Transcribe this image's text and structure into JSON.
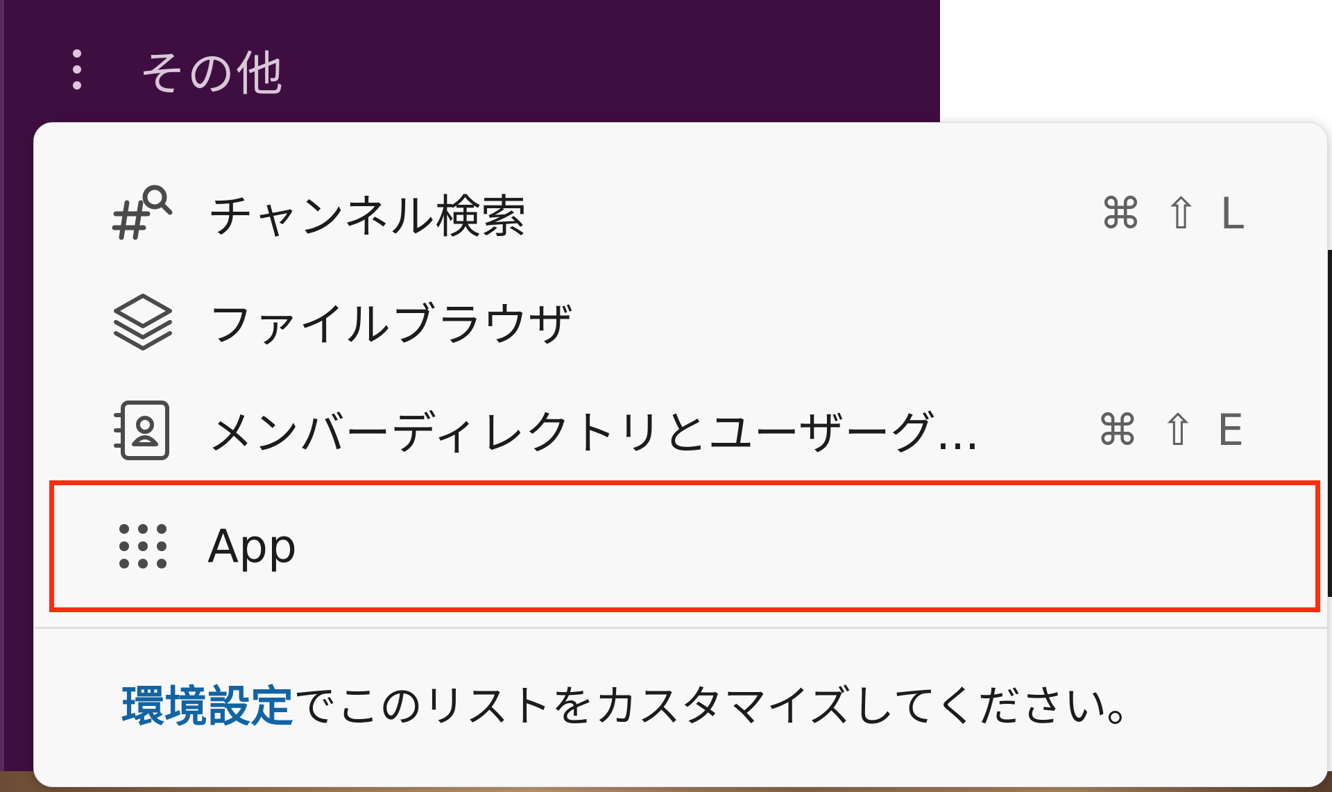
{
  "sidebar": {
    "more_label": "その他",
    "colors": {
      "background": "#3f0e40",
      "text": "#d8c8d8"
    }
  },
  "menu": {
    "items": [
      {
        "label": "チャンネル検索",
        "icon": "channel-search-icon",
        "shortcut": {
          "cmd": "⌘",
          "shift": "⇧",
          "key": "L"
        }
      },
      {
        "label": "ファイルブラウザ",
        "icon": "layers-icon"
      },
      {
        "label": "メンバーディレクトリとユーザーグ...",
        "icon": "member-directory-icon",
        "shortcut": {
          "cmd": "⌘",
          "shift": "⇧",
          "key": "E"
        }
      },
      {
        "label": "App",
        "icon": "apps-grid-icon",
        "highlighted": true
      }
    ],
    "footer": {
      "link": "環境設定",
      "text": "でこのリストをカスタマイズしてください。"
    },
    "colors": {
      "background": "#f8f8f8",
      "link": "#1264a3",
      "highlight": "#ff2d10",
      "shortcut": "#616061"
    }
  }
}
